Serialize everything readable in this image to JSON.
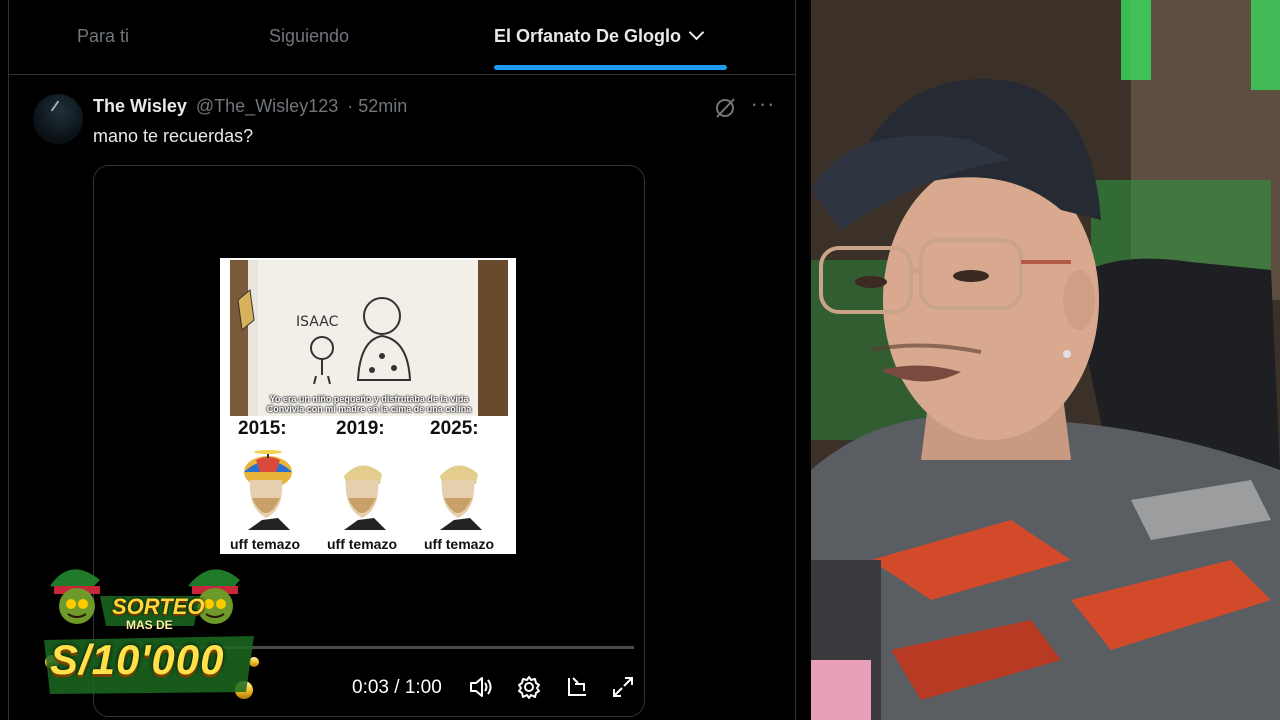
{
  "tabs": [
    {
      "label": "Para ti",
      "active": false
    },
    {
      "label": "Siguiendo",
      "active": false
    },
    {
      "label": "El Orfanato De Gloglo",
      "active": true
    }
  ],
  "post": {
    "display_name": "The Wisley",
    "handle": "@The_Wisley123",
    "separator": "·",
    "time": "52min",
    "text": "mano te recuerdas?"
  },
  "video": {
    "meme": {
      "caption_line1": "Yo era un niño pequeño y disfrutaba de la vida",
      "caption_line2": "Convivía con mi madre en la cima de una colina",
      "drawing_label": "ISAAC",
      "years": [
        "2015:",
        "2019:",
        "2025:"
      ],
      "captions": [
        "uff temazo",
        "uff temazo",
        "uff temazo"
      ]
    },
    "current_time": "0:03",
    "duration": "1:00",
    "time_display": "0:03 / 1:00",
    "progress": 0.01
  },
  "giveaway": {
    "line1": "SORTEO",
    "line2": "MAS DE",
    "amount": "S/10'000"
  },
  "colors": {
    "accent": "#1d9bf0",
    "background": "#000000",
    "muted_text": "#71767b"
  },
  "icons": [
    "grok-icon",
    "more-icon",
    "volume-icon",
    "settings-icon",
    "pip-icon",
    "fullscreen-icon",
    "chevron-down-icon"
  ]
}
